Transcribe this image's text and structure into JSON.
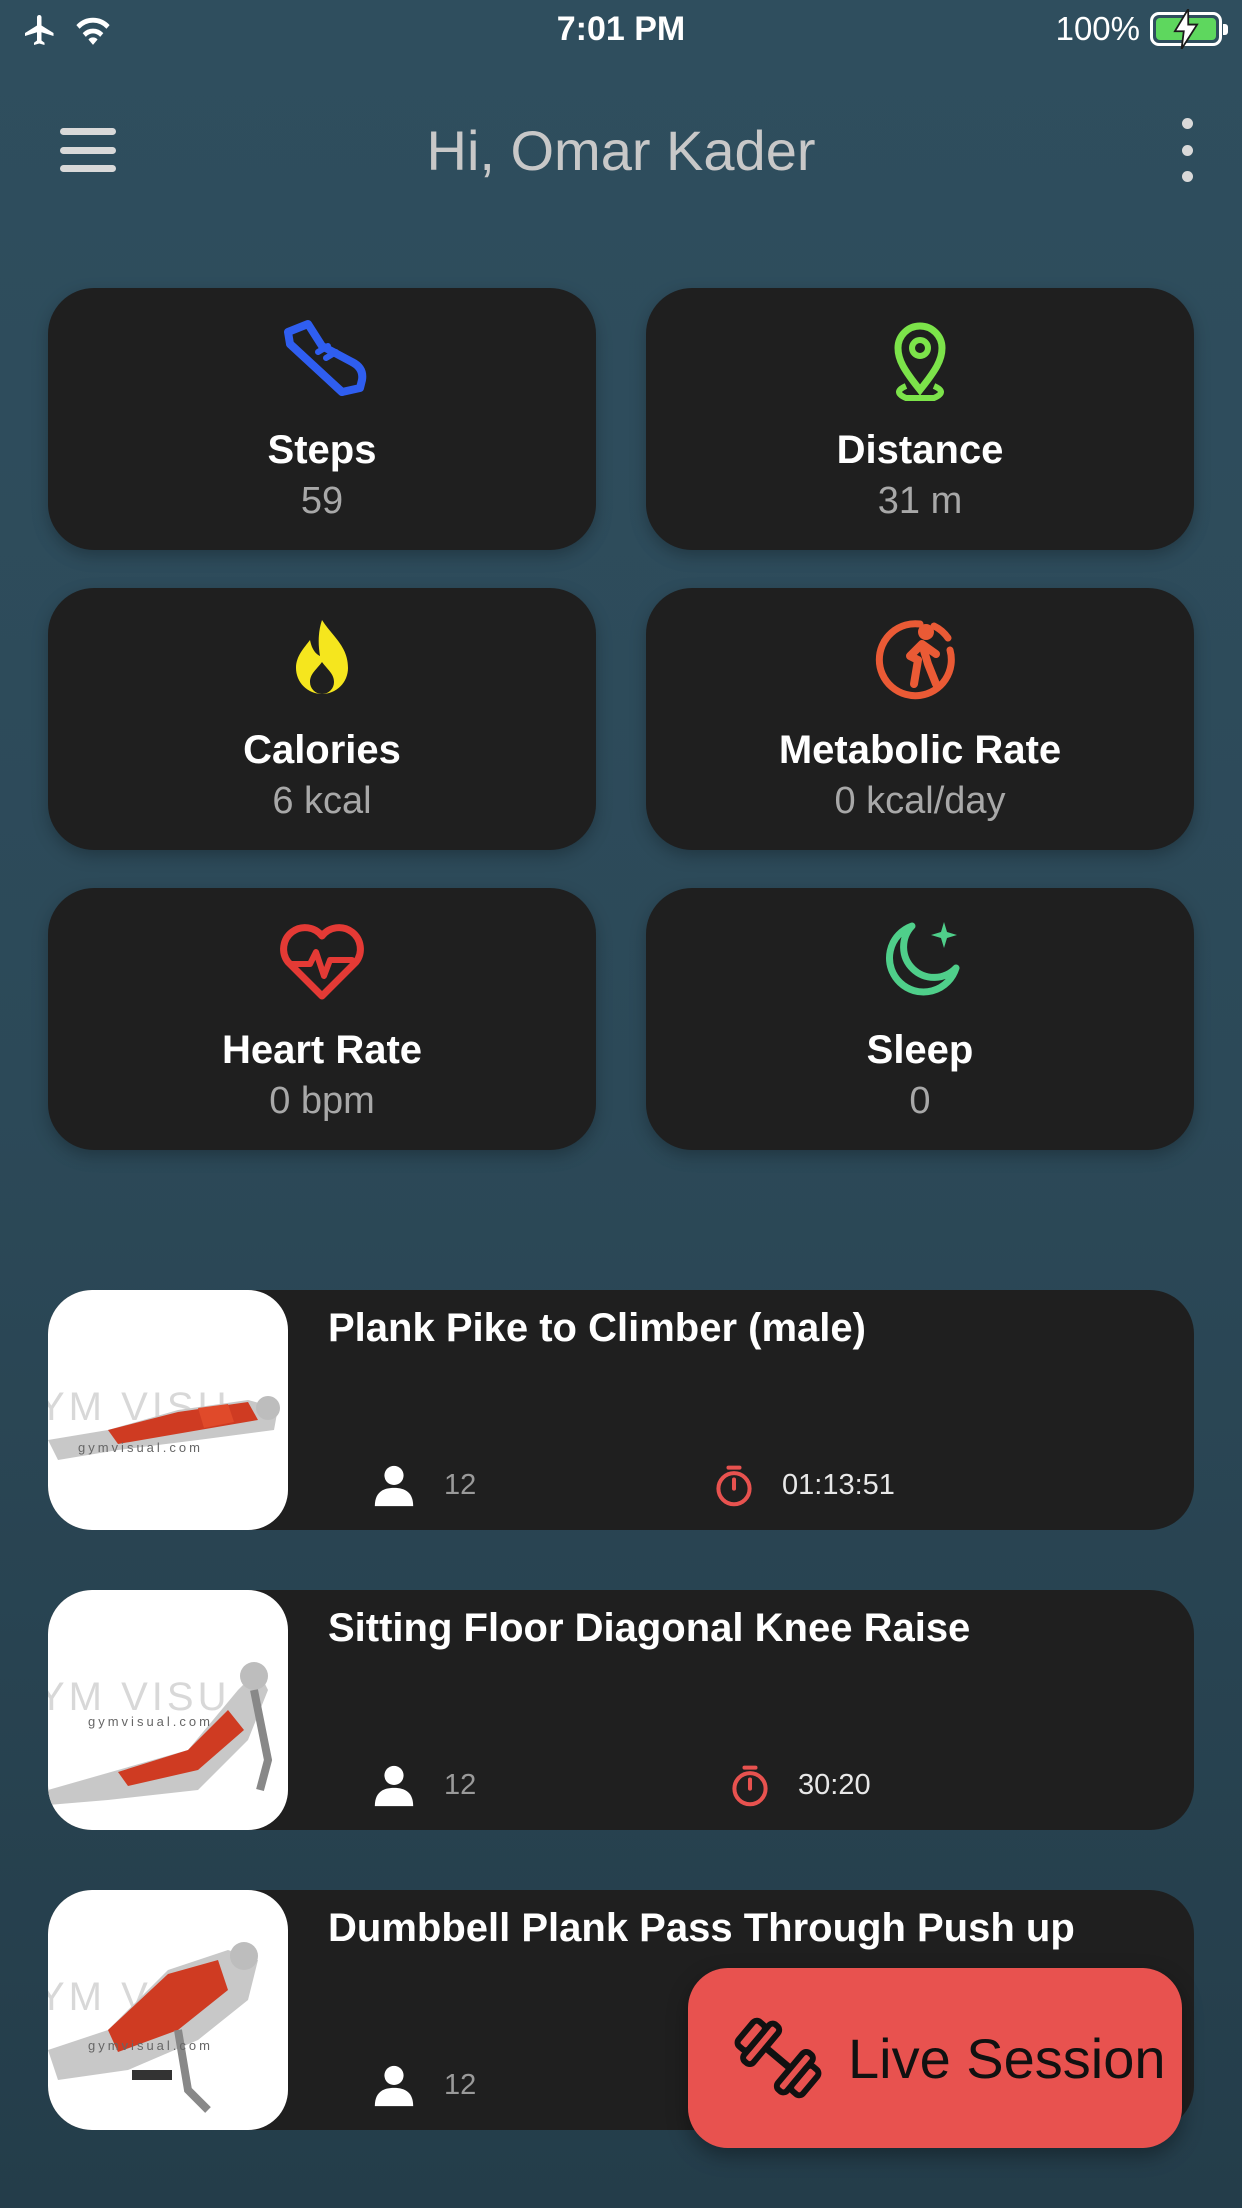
{
  "status_bar": {
    "time": "7:01 PM",
    "battery_percent": "100%",
    "battery_level": 1.0,
    "icons": [
      "airplane-icon",
      "wifi-icon",
      "battery-charging-icon"
    ]
  },
  "header": {
    "greeting": "Hi, Omar Kader",
    "menu_icon": "hamburger-menu-icon",
    "more_icon": "more-vertical-icon"
  },
  "stats": [
    {
      "label": "Steps",
      "value": "59",
      "icon": "shoe-icon",
      "color": "#2f5ef0"
    },
    {
      "label": "Distance",
      "value": "31 m",
      "icon": "location-pin-icon",
      "color": "#7ce34a"
    },
    {
      "label": "Calories",
      "value": "6 kcal",
      "icon": "flame-icon",
      "color": "#f5e61e"
    },
    {
      "label": "Metabolic Rate",
      "value": "0 kcal/day",
      "icon": "walking-person-icon",
      "color": "#ea5a35"
    },
    {
      "label": "Heart Rate",
      "value": "0 bpm",
      "icon": "heart-pulse-icon",
      "color": "#e43a35"
    },
    {
      "label": "Sleep",
      "value": "0",
      "icon": "moon-star-icon",
      "color": "#4fcf8a"
    }
  ],
  "exercises": [
    {
      "title": "Plank Pike to Climber (male)",
      "count": "12",
      "duration": "01:13:51"
    },
    {
      "title": "Sitting Floor Diagonal Knee Raise",
      "count": "12",
      "duration": "30:20"
    },
    {
      "title": "Dumbbell Plank Pass Through Push up",
      "count": "12",
      "duration": ""
    }
  ],
  "fab": {
    "label": "Live Session",
    "icon": "dumbbell-icon",
    "color": "#e8524f"
  }
}
